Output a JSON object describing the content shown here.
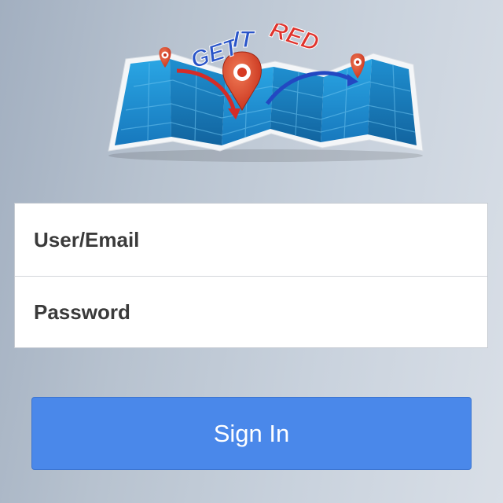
{
  "logo": {
    "word_get": "GET",
    "word_it": "IT",
    "word_red": "RED",
    "colors": {
      "blue_text": "#2a55c8",
      "red_text": "#e0332c",
      "map_blue": "#1f8fd0",
      "pin_red": "#e24a2e"
    }
  },
  "form": {
    "username_placeholder": "User/Email",
    "password_placeholder": "Password"
  },
  "actions": {
    "sign_in_label": "Sign In"
  },
  "colors": {
    "button_bg": "#4a88ea",
    "button_text": "#ffffff"
  }
}
